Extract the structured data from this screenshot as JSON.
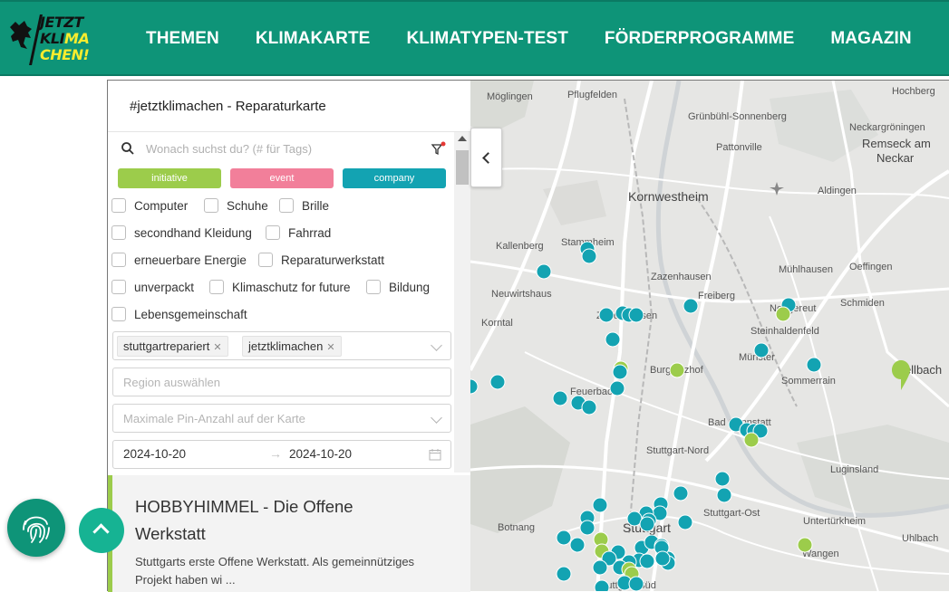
{
  "header": {
    "logo": {
      "line1": "JETZT",
      "line2a": "KLI",
      "line2b": "MA",
      "line3": "CHEN!"
    },
    "nav": [
      "THEMEN",
      "KLIMAKARTE",
      "KLIMATYPEN-TEST",
      "FÖRDERPROGRAMME",
      "MAGAZIN"
    ]
  },
  "panel": {
    "title": "#jetztklimachen - Reparaturkarte",
    "search_placeholder": "Wonach suchst du? (# für Tags)",
    "categories": [
      "initiative",
      "event",
      "company"
    ],
    "checkboxes": [
      "Computer",
      "Schuhe",
      "Brille",
      "secondhand Kleidung",
      "Fahrrad",
      "erneuerbare Energie",
      "Reparaturwerkstatt",
      "unverpackt",
      "Klimaschutz for future",
      "Bildung",
      "Lebensgemeinschaft"
    ],
    "tags": [
      "stuttgartrepariert",
      "jetztklimachen"
    ],
    "region_placeholder": "Region auswählen",
    "max_pins_placeholder": "Maximale Pin-Anzahl auf der Karte",
    "date_from": "2024-10-20",
    "date_to": "2024-10-20",
    "result": {
      "title": "HOBBYHIMMEL - Die Offene Werkstatt",
      "description": "Stuttgarts erste Offene Werkstatt. Als gemeinnütziges Projekt haben wi ..."
    }
  },
  "map": {
    "labels": [
      "Möglingen",
      "Pflugfelden",
      "Grünbühl-Sonnenberg",
      "Hochberg",
      "Neckargröningen",
      "Remseck am",
      "Neckar",
      "Pattonville",
      "Kornwestheim",
      "Aldingen",
      "Stammheim",
      "Kallenberg",
      "Zazenhausen",
      "Mühlhausen",
      "Oeffingen",
      "Neuwirtshaus",
      "Freiberg",
      "Schmiden",
      "Zuffenhausen",
      "Neugereut",
      "Korntal",
      "Steinhaldenfeld",
      "Burgholzhof",
      "Münster",
      "Fellbach",
      "Sommerrain",
      "Feuerbach",
      "Bad Cannstatt",
      "Stuttgart-Nord",
      "Luginsland",
      "Stuttgart-Ost",
      "Botnang",
      "Stuttgart",
      "Untertürkheim",
      "Wangen",
      "Uhlbach",
      "Stuttgart-Süd"
    ],
    "colors": {
      "initiative": "#9ccc4b",
      "event": "#f27f9a",
      "company": "#13a3b2"
    }
  }
}
